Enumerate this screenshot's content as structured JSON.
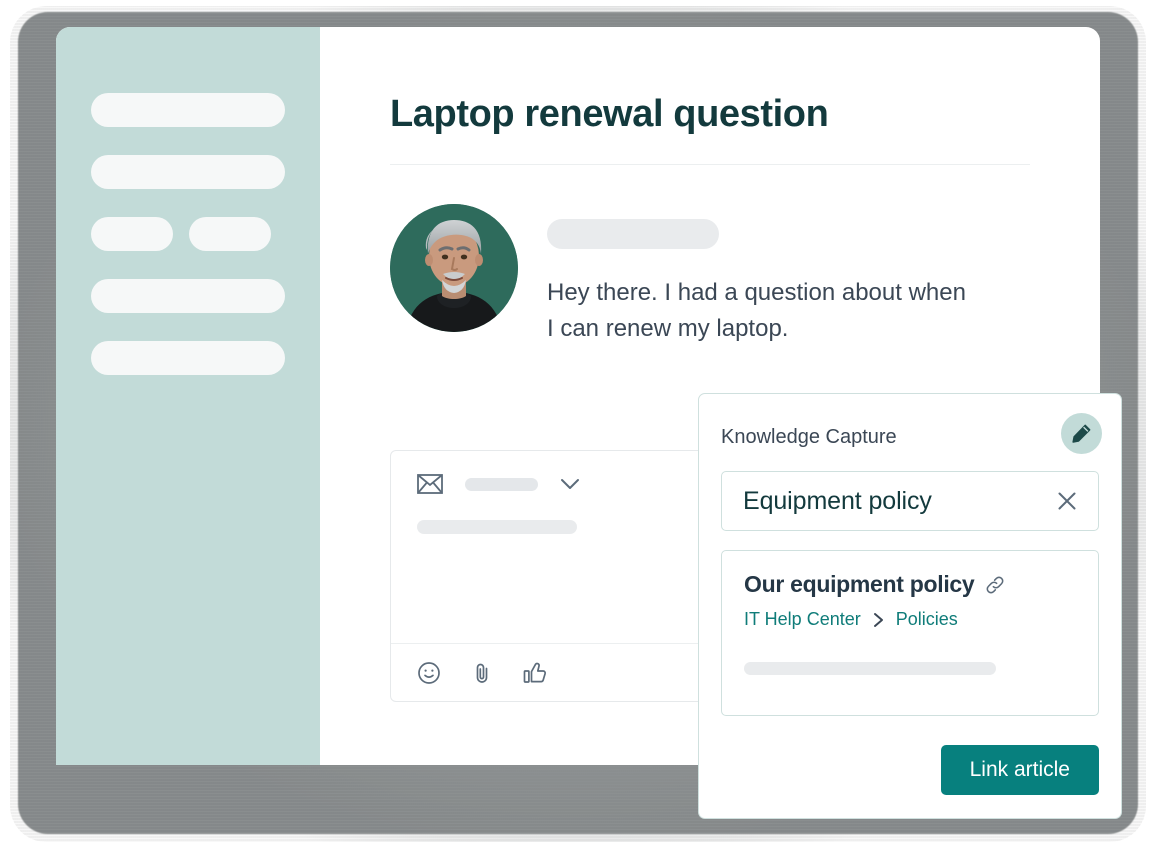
{
  "window": {
    "title": "Laptop renewal question"
  },
  "sidebar": {
    "rows": [
      {
        "pills": [
          "wide"
        ]
      },
      {
        "pills": [
          "wide"
        ]
      },
      {
        "pills": [
          "half",
          "half"
        ]
      },
      {
        "pills": [
          "wide"
        ]
      },
      {
        "pills": [
          "wide"
        ]
      }
    ]
  },
  "message": {
    "avatar_alt": "customer-avatar",
    "author_placeholder": "",
    "body": "Hey there. I had a question about when I can renew my laptop."
  },
  "composer": {
    "channel_icon": "envelope-icon",
    "channel_placeholder": "",
    "dropdown_icon": "chevron-down-icon",
    "body_placeholder": "",
    "toolbar": [
      {
        "name": "emoji-icon"
      },
      {
        "name": "attachment-icon"
      },
      {
        "name": "thumbs-up-icon"
      }
    ]
  },
  "knowledge_capture": {
    "title": "Knowledge Capture",
    "edit_icon": "pencil-icon",
    "search": {
      "value": "Equipment policy",
      "clear_icon": "close-icon"
    },
    "article": {
      "title": "Our equipment policy",
      "link_icon": "link-icon",
      "breadcrumb": {
        "parent": "IT Help Center",
        "separator_icon": "chevron-right-icon",
        "child": "Policies"
      },
      "excerpt_placeholder": ""
    },
    "primary_action": "Link article"
  },
  "colors": {
    "sidebar_bg": "#c2dbd8",
    "title_text": "#133a3d",
    "accent_teal": "#07807e",
    "breadcrumb_teal": "#0f7c79",
    "panel_border": "#cfe0de",
    "placeholder_gray": "#e9ebed",
    "body_text": "#3b4755"
  }
}
